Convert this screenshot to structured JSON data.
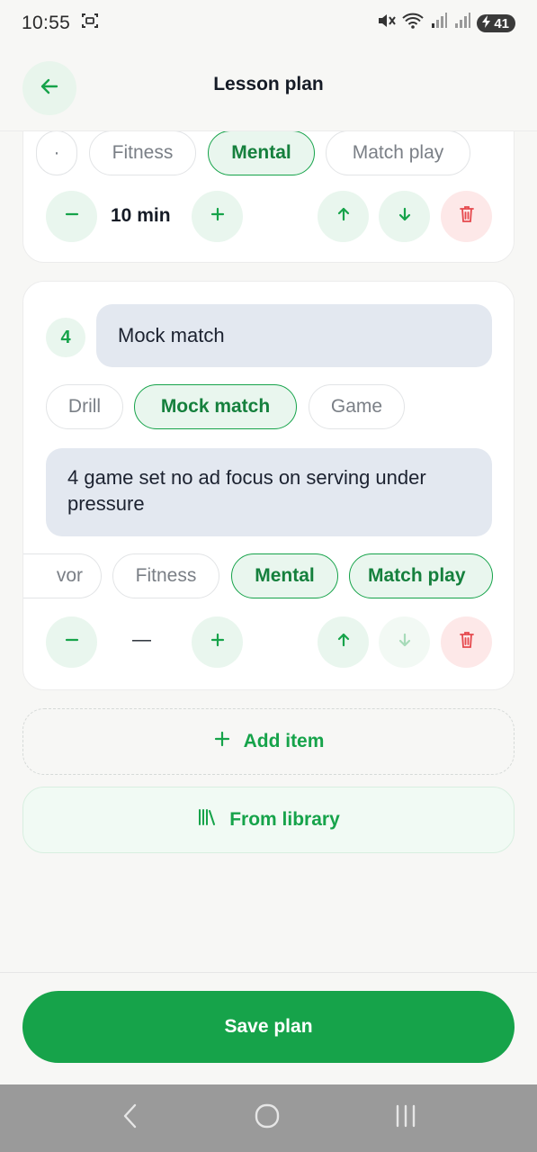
{
  "status_bar": {
    "time": "10:55",
    "battery": "41",
    "icons": [
      "screenshot-icon",
      "mute-icon",
      "wifi-icon",
      "signal-icon",
      "signal-icon"
    ]
  },
  "header": {
    "title": "Lesson plan",
    "back_icon": "arrow-left-icon"
  },
  "cards": [
    {
      "tags": [
        {
          "label": "·",
          "selected": false
        },
        {
          "label": "Fitness",
          "selected": false
        },
        {
          "label": "Mental",
          "selected": true
        },
        {
          "label": "Match play",
          "selected": false
        }
      ],
      "duration": "10 min"
    },
    {
      "number": "4",
      "name": "Mock match",
      "types": [
        {
          "label": "Drill",
          "selected": false
        },
        {
          "label": "Mock match",
          "selected": true
        },
        {
          "label": "Game",
          "selected": false
        }
      ],
      "notes": "4 game set no ad focus on serving under pressure",
      "tags": [
        {
          "label": "vor",
          "selected": false
        },
        {
          "label": "Fitness",
          "selected": false
        },
        {
          "label": "Mental",
          "selected": true
        },
        {
          "label": "Match play",
          "selected": true
        }
      ],
      "duration": "—"
    }
  ],
  "actions": {
    "add_item": "Add item",
    "from_library": "From library"
  },
  "footer": {
    "save_label": "Save plan"
  },
  "colors": {
    "accent": "#16a34a",
    "accent_light": "#e9f6ee",
    "danger": "#e5484d",
    "field_bg": "#e3e8f0"
  }
}
